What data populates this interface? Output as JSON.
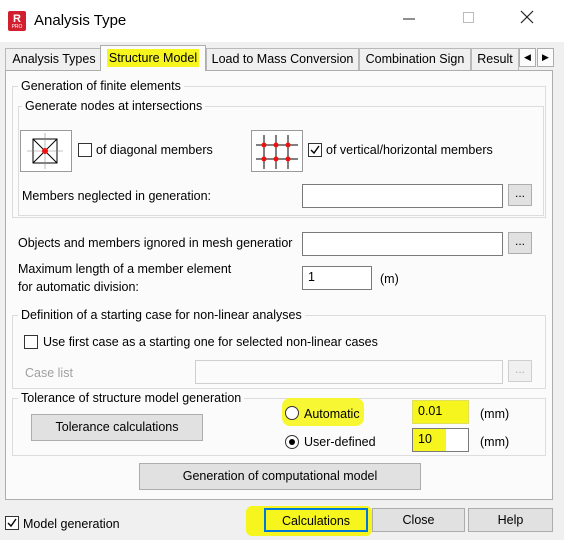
{
  "window": {
    "title": "Analysis Type",
    "app_icon_letter": "R",
    "app_icon_sub": "PRO"
  },
  "tabs": [
    "Analysis Types",
    "Structure Model",
    "Load to Mass Conversion",
    "Combination Sign",
    "Result"
  ],
  "active_tab": "Structure Model",
  "generation": {
    "group_label": "Generation of finite elements",
    "nodes_label": "Generate nodes at intersections",
    "diagonal_label": "of diagonal members",
    "diagonal_checked": false,
    "vertical_label": "of vertical/horizontal members",
    "vertical_checked": true,
    "neglected_label": "Members neglected in generation:",
    "neglected_value": "",
    "browse_label": "..."
  },
  "mesh": {
    "ignored_label": "Objects and members ignored in mesh generatior",
    "ignored_value": "",
    "max_length_label_1": "Maximum length of a member element",
    "max_length_label_2": "for automatic division:",
    "max_length_value": "1",
    "max_length_unit": "(m)"
  },
  "starting_case": {
    "group_label": "Definition of a starting case for non-linear analyses",
    "use_first_label": "Use first case as a starting one for selected non-linear cases",
    "use_first_checked": false,
    "case_list_label": "Case list",
    "case_list_value": ""
  },
  "tolerance": {
    "group_label": "Tolerance of structure model generation",
    "calc_button": "Tolerance calculations",
    "automatic_label": "Automatic",
    "automatic_value": "0.01",
    "user_defined_label": "User-defined",
    "user_defined_value": "10",
    "unit": "(mm)",
    "selected": "User-defined"
  },
  "generate_button": "Generation of computational model",
  "footer": {
    "model_generation_label": "Model generation",
    "model_generation_checked": true,
    "calculations": "Calculations",
    "close": "Close",
    "help": "Help"
  },
  "highlight_color": "#f6f61e",
  "accent_color": "#0078d7"
}
